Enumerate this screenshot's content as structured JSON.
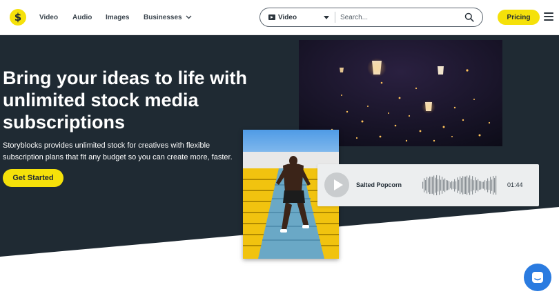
{
  "brand": {
    "logo_glyph": "$",
    "accent": "#f5e10a",
    "dark": "#1f2a33"
  },
  "nav": {
    "items": [
      {
        "label": "Video"
      },
      {
        "label": "Audio"
      },
      {
        "label": "Images"
      },
      {
        "label": "Businesses"
      }
    ],
    "dropdown_icon": "chevron-down-icon"
  },
  "search": {
    "type_selected": "Video",
    "placeholder": "Search...",
    "value": ""
  },
  "header": {
    "pricing_label": "Pricing",
    "menu_icon": "hamburger-icon"
  },
  "hero": {
    "title": "Bring your ideas to life with unlimited stock media subscriptions",
    "subtitle": "Storyblocks provides unlimited stock for creatives with flexible subscription plans that fit any budget so you can create more, faster.",
    "cta_label": "Get Started"
  },
  "audio_preview": {
    "title": "Salted Popcorn",
    "duration": "01:44"
  },
  "chat": {
    "icon": "chat-icon",
    "color": "#2a7be0"
  }
}
